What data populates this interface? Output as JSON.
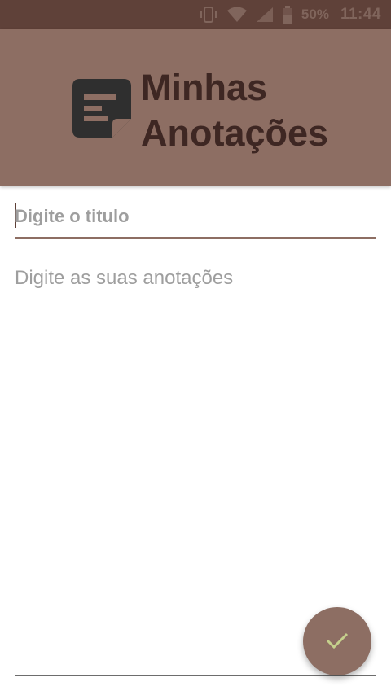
{
  "status_bar": {
    "battery_percent": "50%",
    "time": "11:44",
    "icons": [
      "vibrate-icon",
      "wifi-icon",
      "signal-icon",
      "battery-icon"
    ]
  },
  "header": {
    "title_line1": "Minhas",
    "title_line2": "Anotações",
    "logo_icon": "note-icon"
  },
  "form": {
    "title_placeholder": "Digite o titulo",
    "title_value": "",
    "notes_placeholder": "Digite as suas anotações",
    "notes_value": ""
  },
  "fab": {
    "icon": "check-icon"
  },
  "colors": {
    "status_bar": "#5f4139",
    "primary": "#8d6e63",
    "title_text": "#3e2723",
    "check_accent": "#c5d08c"
  }
}
